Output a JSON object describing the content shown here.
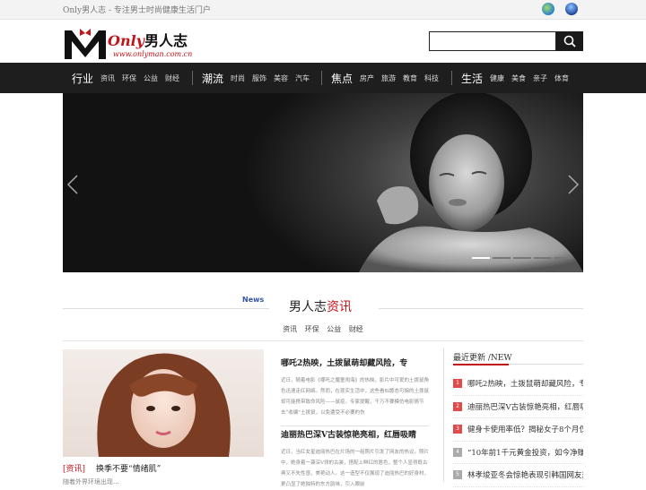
{
  "topbar": {
    "tagline": "Only男人志 - 专注男士时尚健康生活门户"
  },
  "logo": {
    "only": "Only",
    "cn": "男人志",
    "url": "www.onlyman.com.cn"
  },
  "search": {
    "placeholder": ""
  },
  "nav": [
    {
      "main": "行业",
      "subs": [
        "资讯",
        "环保",
        "公益",
        "财经"
      ]
    },
    {
      "main": "潮流",
      "subs": [
        "时尚",
        "服饰",
        "美容",
        "汽车"
      ]
    },
    {
      "main": "焦点",
      "subs": [
        "房产",
        "旅游",
        "教育",
        "科技"
      ]
    },
    {
      "main": "生活",
      "subs": [
        "健康",
        "美食",
        "亲子",
        "体育"
      ]
    }
  ],
  "banner": {
    "slide_count": 5,
    "active_slide": 1
  },
  "section": {
    "en": "News",
    "title_a": "男人志",
    "title_b": "资讯",
    "tabs": [
      "资讯",
      "环保",
      "公益",
      "财经"
    ]
  },
  "feature": {
    "tag": "[资讯]",
    "title": "换季不要“情绪肌”",
    "excerpt": "随着外界环境出现..."
  },
  "articles": [
    {
      "title": "哪吒2热映，土拨鼠萌却藏风险，专",
      "body": "近日，随着电影《哪吒之魔童闹海》的热映，影片中可爱的土拨鼠角色迅速走红网络。然而，在现实生活中，这些看似憨态可掬的土拨鼠却可能携带致命风险——鼠疫。专家提醒，千万不要模仿电影情节去“收编”土拨鼠，以免遭受不必要的伤"
    },
    {
      "title": "迪丽热巴深V古装惊艳亮相，红唇吸睛",
      "body": "近日，当红女星迪丽热巴在片场的一组照片引发了网友的热议。照片中，她身着一袭深V领的古装，搭配上鲜红的唇色，整个人显得既古典又不失性感，美艳动人。这一造型不仅展现了迪丽热巴的好身材，更凸显了她独特的东方韵味，引入眼前"
    }
  ],
  "latest": {
    "title": "最近更新 /NEW",
    "items": [
      "哪吒2热映，土拨鼠萌却藏风险，专",
      "迪丽热巴深V古装惊艳亮相，红唇吸睛",
      "健身卡使用率低？揭秘女子8个月仅",
      "“10年前1千元黄金投资，如今净赚",
      "林孝埈亚冬会惊艳表现引韩国网友热"
    ]
  }
}
